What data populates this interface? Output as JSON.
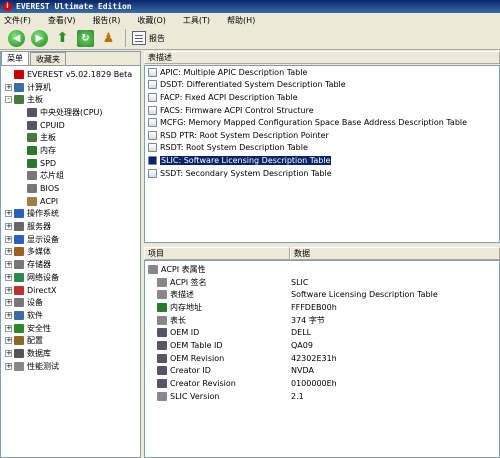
{
  "window": {
    "title": "EVEREST Ultimate Edition",
    "logo": "i"
  },
  "menu": [
    "文件(F)",
    "查看(V)",
    "报告(R)",
    "收藏(O)",
    "工具(T)",
    "帮助(H)"
  ],
  "toolbar": {
    "report_label": "报告"
  },
  "left_tabs": [
    "菜单",
    "收藏夹"
  ],
  "tree": [
    {
      "label": "EVEREST v5.02.1829 Beta",
      "level": 0,
      "toggle": "",
      "icon": "#c00"
    },
    {
      "label": "计算机",
      "level": 0,
      "toggle": "+",
      "icon": "#3a6ea5"
    },
    {
      "label": "主板",
      "level": 0,
      "toggle": "-",
      "icon": "#4a7a3a"
    },
    {
      "label": "中央处理器(CPU)",
      "level": 1,
      "toggle": "",
      "icon": "#556"
    },
    {
      "label": "CPUID",
      "level": 1,
      "toggle": "",
      "icon": "#556"
    },
    {
      "label": "主板",
      "level": 1,
      "toggle": "",
      "icon": "#4a7a3a"
    },
    {
      "label": "内存",
      "level": 1,
      "toggle": "",
      "icon": "#2a7a2a"
    },
    {
      "label": "SPD",
      "level": 1,
      "toggle": "",
      "icon": "#2a7a2a"
    },
    {
      "label": "芯片组",
      "level": 1,
      "toggle": "",
      "icon": "#777"
    },
    {
      "label": "BIOS",
      "level": 1,
      "toggle": "",
      "icon": "#777"
    },
    {
      "label": "ACPI",
      "level": 1,
      "toggle": "",
      "icon": "#a08040"
    },
    {
      "label": "操作系统",
      "level": 0,
      "toggle": "+",
      "icon": "#2a60c0"
    },
    {
      "label": "服务器",
      "level": 0,
      "toggle": "+",
      "icon": "#666"
    },
    {
      "label": "显示设备",
      "level": 0,
      "toggle": "+",
      "icon": "#2a60c0"
    },
    {
      "label": "多媒体",
      "level": 0,
      "toggle": "+",
      "icon": "#a06020"
    },
    {
      "label": "存储器",
      "level": 0,
      "toggle": "+",
      "icon": "#777"
    },
    {
      "label": "网络设备",
      "level": 0,
      "toggle": "+",
      "icon": "#2a8a4a"
    },
    {
      "label": "DirectX",
      "level": 0,
      "toggle": "+",
      "icon": "#c03030"
    },
    {
      "label": "设备",
      "level": 0,
      "toggle": "+",
      "icon": "#777"
    },
    {
      "label": "软件",
      "level": 0,
      "toggle": "+",
      "icon": "#3a6ea5"
    },
    {
      "label": "安全性",
      "level": 0,
      "toggle": "+",
      "icon": "#2a8a2a"
    },
    {
      "label": "配置",
      "level": 0,
      "toggle": "+",
      "icon": "#8a6a2a"
    },
    {
      "label": "数据库",
      "level": 0,
      "toggle": "+",
      "icon": "#555"
    },
    {
      "label": "性能测试",
      "level": 0,
      "toggle": "+",
      "icon": "#888"
    }
  ],
  "table_list": {
    "header": "表描述",
    "items": [
      "APIC: Multiple APIC Description Table",
      "DSDT: Differentiated System Description Table",
      "FACP: Fixed ACPI Description Table",
      "FACS: Firmware ACPI Control Structure",
      "MCFG: Memory Mapped Configuration Space Base Address Description Table",
      "RSD PTR: Root System Description Pointer",
      "RSDT: Root System Description Table",
      "SLIC: Software Licensing Description Table",
      "SSDT: Secondary System Description Table"
    ],
    "selected": 7
  },
  "details": {
    "col_item": "项目",
    "col_value": "数据",
    "rows": [
      {
        "k": "ACPI 表属性",
        "v": "",
        "indent": 0,
        "icon": "#888"
      },
      {
        "k": "ACPI 签名",
        "v": "SLIC",
        "indent": 1,
        "icon": "#888"
      },
      {
        "k": "表描述",
        "v": "Software Licensing Description Table",
        "indent": 1,
        "icon": "#888"
      },
      {
        "k": "内存地址",
        "v": "FFFDEB00h",
        "indent": 1,
        "icon": "#2a7a2a"
      },
      {
        "k": "表长",
        "v": "374 字节",
        "indent": 1,
        "icon": "#888"
      },
      {
        "k": "OEM ID",
        "v": "DELL",
        "indent": 1,
        "icon": "#556"
      },
      {
        "k": "OEM Table ID",
        "v": "QA09",
        "indent": 1,
        "icon": "#556"
      },
      {
        "k": "OEM Revision",
        "v": "42302E31h",
        "indent": 1,
        "icon": "#556"
      },
      {
        "k": "Creator ID",
        "v": "NVDA",
        "indent": 1,
        "icon": "#556"
      },
      {
        "k": "Creator Revision",
        "v": "0100000Eh",
        "indent": 1,
        "icon": "#556"
      },
      {
        "k": "SLIC Version",
        "v": "2.1",
        "indent": 1,
        "icon": "#888"
      }
    ]
  }
}
